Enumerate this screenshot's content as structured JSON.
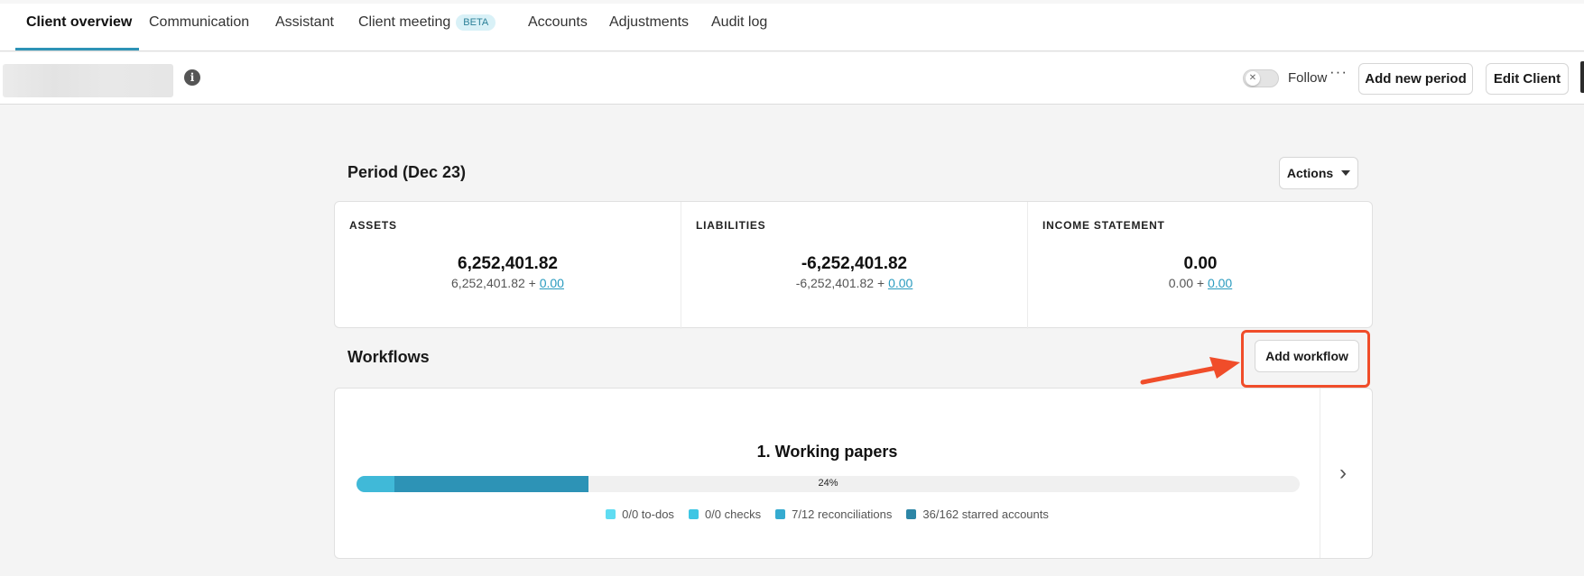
{
  "tabs": [
    {
      "label": "Client overview",
      "active": true
    },
    {
      "label": "Communication"
    },
    {
      "label": "Assistant"
    },
    {
      "label": "Client meeting",
      "badge": "BETA"
    },
    {
      "label": "Accounts"
    },
    {
      "label": "Adjustments"
    },
    {
      "label": "Audit log"
    }
  ],
  "header": {
    "follow_label": "Follow",
    "toggle_on": false,
    "add_period_label": "Add new period",
    "edit_client_label": "Edit Client"
  },
  "period": {
    "title": "Period (Dec 23)",
    "actions_label": "Actions"
  },
  "stats": [
    {
      "label": "ASSETS",
      "value": "6,252,401.82",
      "base": "6,252,401.82 + ",
      "adjustment": "0.00"
    },
    {
      "label": "LIABILITIES",
      "value": "-6,252,401.82",
      "base": "-6,252,401.82 + ",
      "adjustment": "0.00"
    },
    {
      "label": "INCOME STATEMENT",
      "value": "0.00",
      "base": "0.00 + ",
      "adjustment": "0.00"
    }
  ],
  "workflows": {
    "title": "Workflows",
    "add_label": "Add workflow",
    "items": [
      {
        "name": "1. Working papers",
        "progress_label": "24%",
        "progress_segments": [
          {
            "fraction": 0.04,
            "color": "#40b9d8"
          },
          {
            "fraction": 0.206,
            "color": "#2d93b6"
          }
        ],
        "legend": [
          {
            "text": "0/0 to-dos",
            "color": "#5fdcf2"
          },
          {
            "text": "0/0 checks",
            "color": "#3dc6e4"
          },
          {
            "text": "7/12 reconciliations",
            "color": "#35abd0"
          },
          {
            "text": "36/162 starred accounts",
            "color": "#2d86a6"
          }
        ]
      }
    ]
  },
  "colors": {
    "accent": "#2d93b6",
    "link": "#2a9bbf",
    "highlight": "#f04d2a"
  }
}
